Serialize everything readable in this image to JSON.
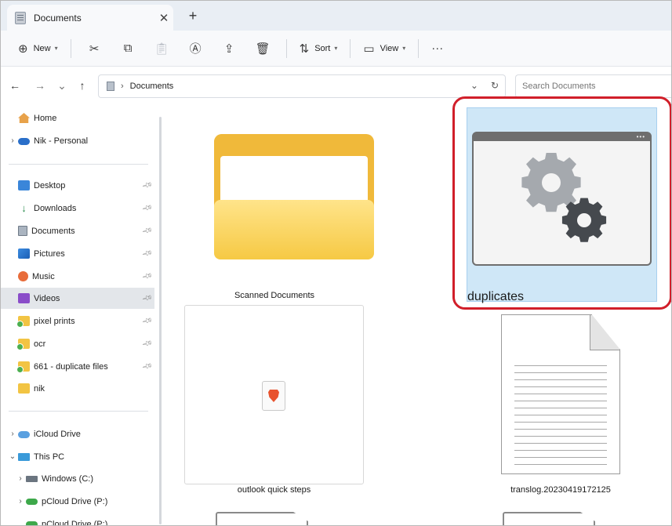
{
  "window": {
    "tab_title": "Documents",
    "tab_close": "✕",
    "new_tab": "+"
  },
  "toolbar": {
    "new_label": "New",
    "sort_label": "Sort",
    "view_label": "View",
    "more": "···"
  },
  "address": {
    "back": "←",
    "forward": "→",
    "recent": "⌄",
    "up": "↑",
    "crumb_sep": "›",
    "crumb": "Documents",
    "refresh": "↻",
    "expand": "⌄"
  },
  "search": {
    "placeholder": "Search Documents"
  },
  "sidebar": {
    "top": [
      {
        "label": "Home",
        "icon": "home-icon"
      },
      {
        "label": "Nik - Personal",
        "icon": "onedrive-icon"
      }
    ],
    "quick": [
      {
        "label": "Desktop",
        "icon": "desktop-icon"
      },
      {
        "label": "Downloads",
        "icon": "downloads-icon"
      },
      {
        "label": "Documents",
        "icon": "documents-icon"
      },
      {
        "label": "Pictures",
        "icon": "pictures-icon"
      },
      {
        "label": "Music",
        "icon": "music-icon"
      },
      {
        "label": "Videos",
        "icon": "videos-icon"
      },
      {
        "label": "pixel prints",
        "icon": "folder-icon"
      },
      {
        "label": "ocr",
        "icon": "folder-icon"
      },
      {
        "label": "661 - duplicate files",
        "icon": "folder-icon"
      },
      {
        "label": "nik",
        "icon": "folder-icon"
      }
    ],
    "bottom": [
      {
        "label": "iCloud Drive",
        "icon": "icloud-icon"
      },
      {
        "label": "This PC",
        "icon": "pc-icon"
      },
      {
        "label": "Windows (C:)",
        "icon": "drive-icon"
      },
      {
        "label": "pCloud Drive (P:)",
        "icon": "pcloud-icon"
      },
      {
        "label": "pCloud Drive (P:)",
        "icon": "pcloud-icon"
      }
    ]
  },
  "files": [
    {
      "name": "Scanned Documents",
      "kind": "folder"
    },
    {
      "name": "duplicates",
      "kind": "shortcut",
      "selected": true
    },
    {
      "name": "outlook quick steps",
      "kind": "brave-file"
    },
    {
      "name": "translog.20230419172125",
      "kind": "text-file"
    }
  ],
  "highlight_color": "#d11f2a"
}
